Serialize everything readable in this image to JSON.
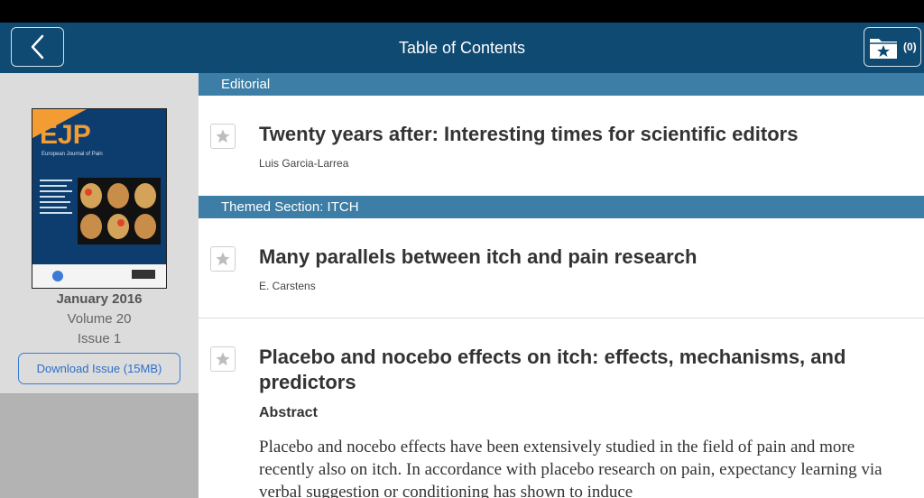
{
  "header": {
    "title": "Table of Contents",
    "favorites_count": "(0)"
  },
  "issue": {
    "cover": {
      "logo": "EJP",
      "subtitle": "European Journal of Pain"
    },
    "date": "January 2016",
    "volume": "Volume 20",
    "issue": "Issue 1",
    "download_label": "Download Issue (15MB)"
  },
  "sections": [
    {
      "label": "Editorial"
    },
    {
      "label": "Themed Section: ITCH"
    }
  ],
  "articles": [
    {
      "title": "Twenty years after: Interesting times for scientific editors",
      "author": "Luis Garcia-Larrea"
    },
    {
      "title": "Many parallels between itch and pain research",
      "author": "E. Carstens"
    },
    {
      "title": "Placebo and nocebo effects on itch: effects, mechanisms, and predictors",
      "abstract_label": "Abstract",
      "abstract_text": "Placebo and nocebo effects have been extensively studied in the field of pain and more recently also on itch. In accordance with placebo research on pain, expectancy learning via verbal suggestion or conditioning has shown to induce"
    }
  ],
  "colors": {
    "appbar": "#0f4a72",
    "section": "#3c7ea6",
    "sidebar": "#dcdcdc",
    "accent": "#2d6fc7"
  }
}
